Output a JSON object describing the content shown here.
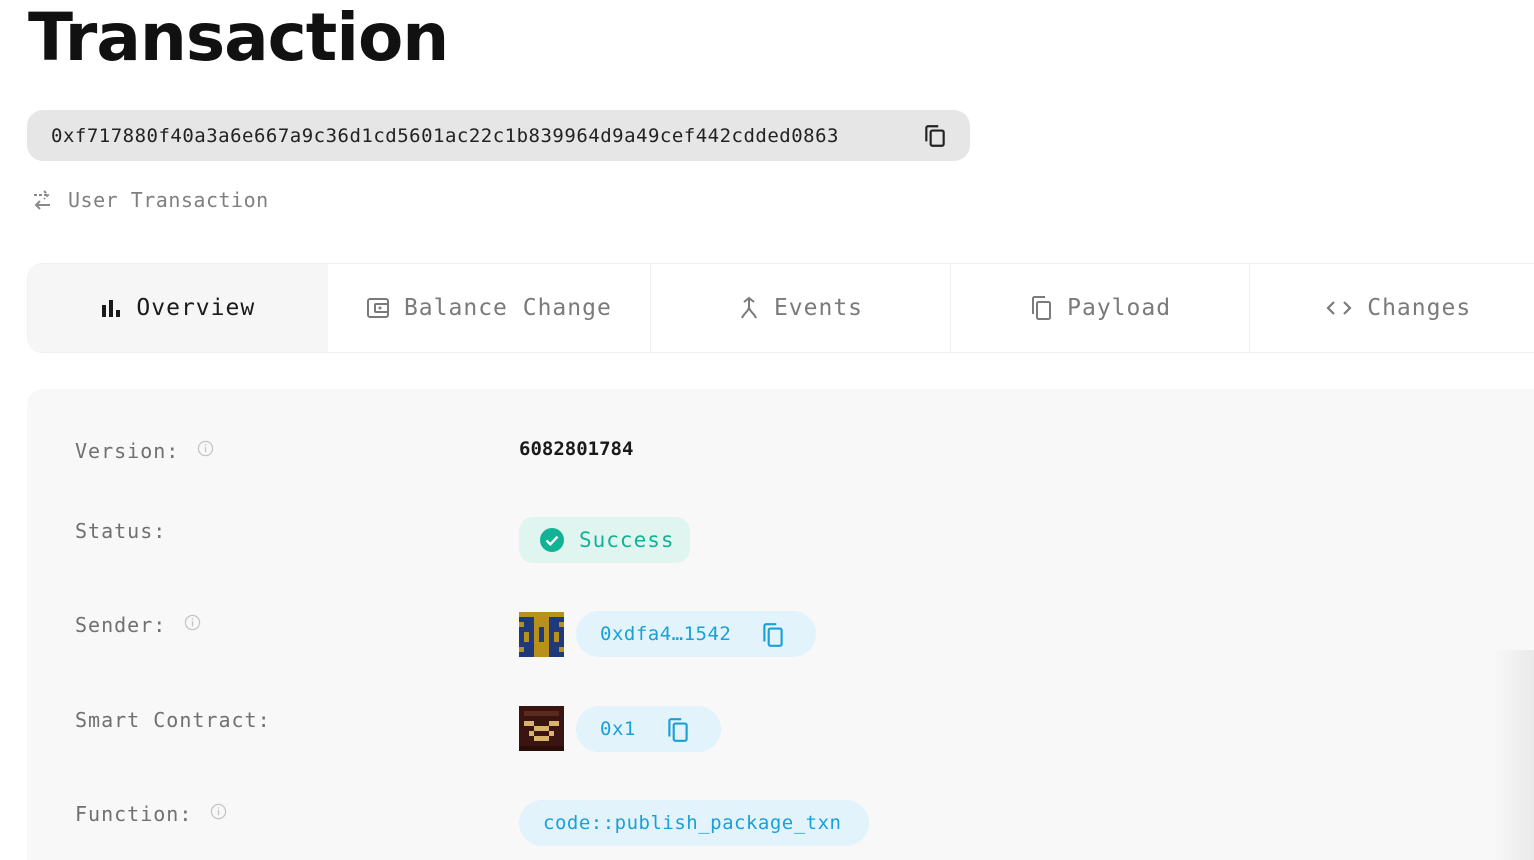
{
  "page": {
    "title": "Transaction"
  },
  "hash": {
    "value": "0xf717880f40a3a6e667a9c36d1cd5601ac22c1b839964d9a49cef442cdded0863"
  },
  "txn_type": {
    "label": "User Transaction"
  },
  "tabs": [
    {
      "label": "Overview",
      "icon": "bar-chart-icon",
      "active": true
    },
    {
      "label": "Balance Change",
      "icon": "wallet-icon",
      "active": false
    },
    {
      "label": "Events",
      "icon": "merge-icon",
      "active": false
    },
    {
      "label": "Payload",
      "icon": "copy-icon",
      "active": false
    },
    {
      "label": "Changes",
      "icon": "code-icon",
      "active": false
    }
  ],
  "overview": {
    "version": {
      "label": "Version:",
      "value": "6082801784"
    },
    "status": {
      "label": "Status:",
      "value": "Success"
    },
    "sender": {
      "label": "Sender:",
      "value": "0xdfa4…1542"
    },
    "smart_contract": {
      "label": "Smart Contract:",
      "value": "0x1"
    },
    "function": {
      "label": "Function:",
      "value": "code::publish_package_txn"
    }
  },
  "colors": {
    "success_text": "#12b394",
    "success_bg": "#e0f4f0",
    "link_text": "#1aa0d8",
    "link_bg": "#e3f3fb"
  }
}
